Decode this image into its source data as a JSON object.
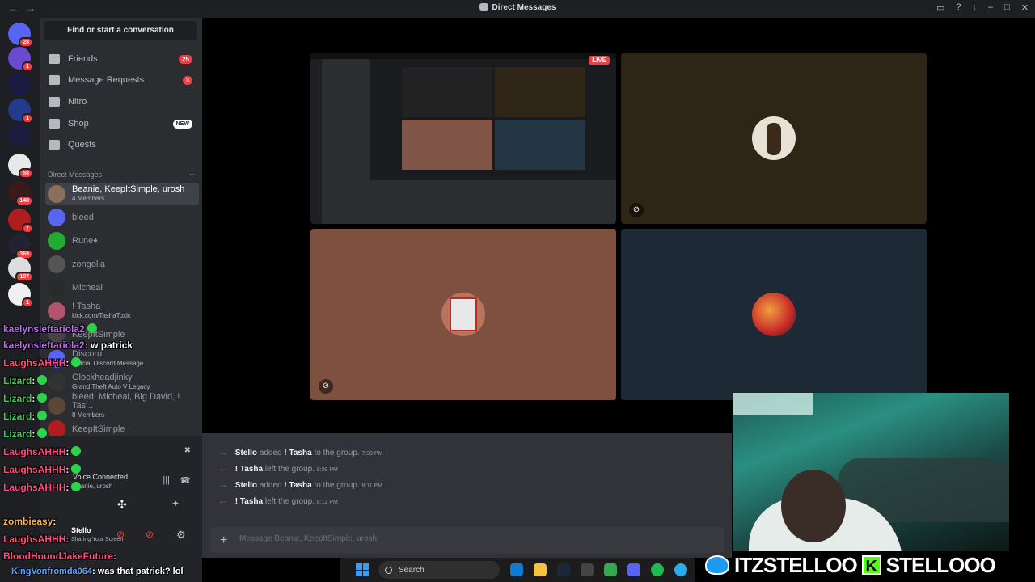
{
  "window": {
    "title": "Direct Messages"
  },
  "rail": {
    "badges": [
      "28",
      "1",
      "1",
      "58",
      "148",
      "7",
      "369",
      "187",
      "1"
    ]
  },
  "sidebar": {
    "search_label": "Find or start a conversation",
    "nav": [
      {
        "label": "Friends",
        "badge": "25"
      },
      {
        "label": "Message Requests",
        "badge": "3"
      },
      {
        "label": "Nitro"
      },
      {
        "label": "Shop",
        "badge_new": "NEW"
      },
      {
        "label": "Quests"
      }
    ],
    "dm_header": "Direct Messages",
    "dms": [
      {
        "name": "Beanie, KeepItSimple, urosh",
        "sub": "4 Members"
      },
      {
        "name": "bleed"
      },
      {
        "name": "Rune♦"
      },
      {
        "name": "zongolia"
      },
      {
        "name": "Micheal"
      },
      {
        "name": "! Tasha",
        "sub": "kick.com/TashaToxic"
      },
      {
        "name": "KeepItSimple"
      },
      {
        "name": "Discord",
        "sub": "Official Discord Message"
      },
      {
        "name": "Glockheadjinky",
        "sub": "Grand Theft Auto V Legacy"
      },
      {
        "name": "bleed, Micheal, Big David, ! Tas...",
        "sub": "8 Members"
      },
      {
        "name": "KeepItSimple"
      }
    ]
  },
  "voice": {
    "title": "Voice Connected",
    "channel": "Beanie, urosh",
    "user": "Stello",
    "status": "Sharing Your Screen"
  },
  "stream": {
    "live_label": "LIVE"
  },
  "messages": [
    {
      "dir": "in",
      "actor": "Stello",
      "verb": "added",
      "target": "! Tasha",
      "rest": "to the group.",
      "time": "7:39 PM"
    },
    {
      "dir": "out",
      "actor": "! Tasha",
      "verb": "left the group.",
      "target": "",
      "rest": "",
      "time": "8:09 PM"
    },
    {
      "dir": "in",
      "actor": "Stello",
      "verb": "added",
      "target": "! Tasha",
      "rest": "to the group.",
      "time": "8:11 PM"
    },
    {
      "dir": "out",
      "actor": "! Tasha",
      "verb": "left the group.",
      "target": "",
      "rest": "",
      "time": "8:12 PM"
    }
  ],
  "composer": {
    "placeholder": "Message Beanie, KeepItSimple, urosh"
  },
  "chat_overlay": [
    {
      "user": "kaelynsleftariola2",
      "text": ""
    },
    {
      "user": "kaelynsleftariola2",
      "text": ": w patrick"
    },
    {
      "user": "LaughsAHHH",
      "text": ":"
    },
    {
      "user": "Lizard",
      "text": ":"
    },
    {
      "user": "Lizard",
      "text": ":"
    },
    {
      "user": "Lizard",
      "text": ":"
    },
    {
      "user": "Lizard",
      "text": ":"
    },
    {
      "user": "LaughsAHHH",
      "text": ":"
    },
    {
      "user": "LaughsAHHH",
      "text": ":"
    },
    {
      "user": "LaughsAHHH",
      "text": ":"
    },
    {
      "user": "zombieasy",
      "text": ":"
    },
    {
      "user": "LaughsAHHH",
      "text": ":"
    },
    {
      "user": "BloodHoundJakeFuture",
      "text": ":"
    },
    {
      "user": "KingVonfromda064",
      "text": ": was that patrick? lol"
    }
  ],
  "taskbar": {
    "search_label": "Search"
  },
  "banner": {
    "twitter": "ITZSTELLOO",
    "kick_letter": "K",
    "kick": "STELLOOO"
  },
  "colors": {
    "discord_bg": "#313338",
    "sidebar_bg": "#2b2d31",
    "rail_bg": "#1e1f22",
    "accent": "#5865f2",
    "danger": "#f23f43",
    "online": "#23a55a"
  }
}
